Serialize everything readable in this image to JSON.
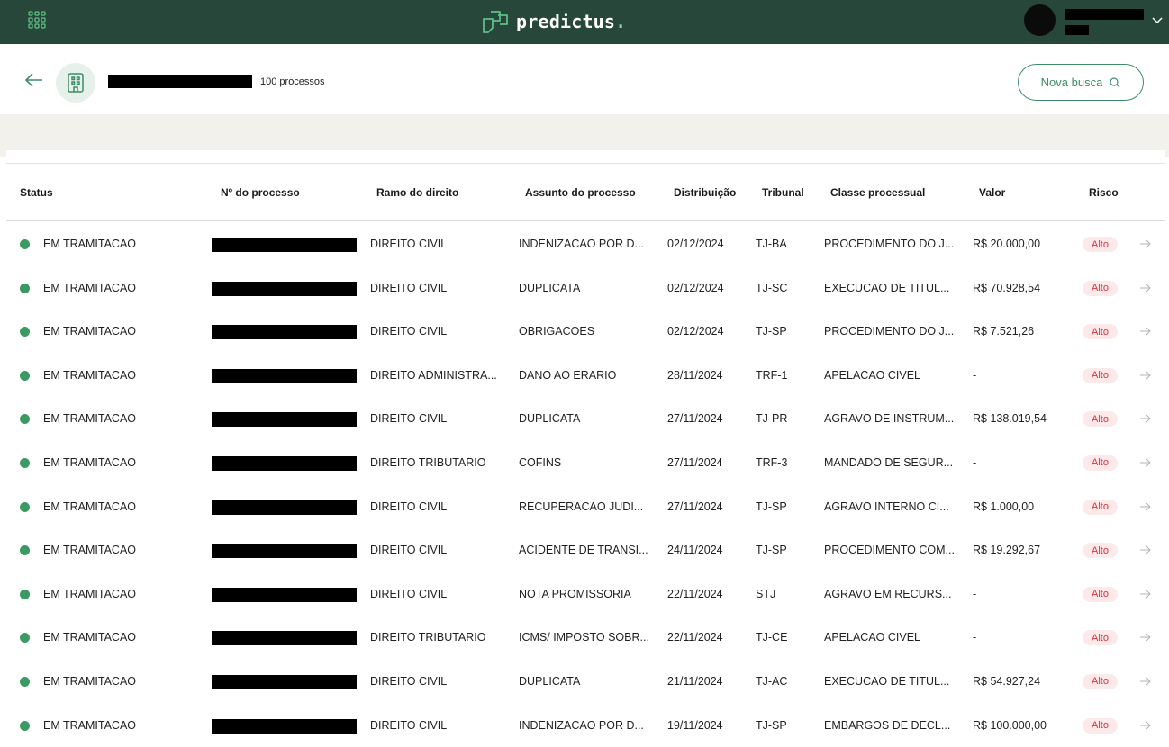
{
  "topbar": {
    "logo_text": "predictus",
    "logo_dot": ".",
    "icons": {
      "apps": "grid-icon",
      "chevron": "chevron-down-icon"
    }
  },
  "header": {
    "process_count": "100 processos",
    "nova_busca": "Nova busca",
    "icons": {
      "back": "arrow-left-icon",
      "entity": "building-icon",
      "search": "search-icon"
    }
  },
  "colors": {
    "topbar": "#26473a",
    "accent": "#3f8c68",
    "status_dot": "#3a9a62",
    "risk_text": "#d9333f",
    "risk_bg": "#fde9ea",
    "band": "#f2f1ec"
  },
  "table": {
    "columns": {
      "status": "Status",
      "numero": "Nº do processo",
      "ramo": "Ramo do direito",
      "assunto": "Assunto do processo",
      "distribuicao": "Distribuição",
      "tribunal": "Tribunal",
      "classe": "Classe processual",
      "valor": "Valor",
      "risco": "Risco"
    },
    "rows": [
      {
        "status": "EM TRAMITACAO",
        "ramo": "DIREITO CIVIL",
        "assunto": "INDENIZACAO POR D...",
        "distribuicao": "02/12/2024",
        "tribunal": "TJ-BA",
        "classe": "PROCEDIMENTO DO J...",
        "valor": "R$ 20.000,00",
        "risco": "Alto"
      },
      {
        "status": "EM TRAMITACAO",
        "ramo": "DIREITO CIVIL",
        "assunto": "DUPLICATA",
        "distribuicao": "02/12/2024",
        "tribunal": "TJ-SC",
        "classe": "EXECUCAO DE TITUL...",
        "valor": "R$ 70.928,54",
        "risco": "Alto"
      },
      {
        "status": "EM TRAMITACAO",
        "ramo": "DIREITO CIVIL",
        "assunto": "OBRIGACOES",
        "distribuicao": "02/12/2024",
        "tribunal": "TJ-SP",
        "classe": "PROCEDIMENTO DO J...",
        "valor": "R$ 7.521,26",
        "risco": "Alto"
      },
      {
        "status": "EM TRAMITACAO",
        "ramo": "DIREITO ADMINISTRA...",
        "assunto": "DANO AO ERARIO",
        "distribuicao": "28/11/2024",
        "tribunal": "TRF-1",
        "classe": "APELACAO CIVEL",
        "valor": "-",
        "risco": "Alto"
      },
      {
        "status": "EM TRAMITACAO",
        "ramo": "DIREITO CIVIL",
        "assunto": "DUPLICATA",
        "distribuicao": "27/11/2024",
        "tribunal": "TJ-PR",
        "classe": "AGRAVO DE INSTRUM...",
        "valor": "R$ 138.019,54",
        "risco": "Alto"
      },
      {
        "status": "EM TRAMITACAO",
        "ramo": "DIREITO TRIBUTARIO",
        "assunto": "COFINS",
        "distribuicao": "27/11/2024",
        "tribunal": "TRF-3",
        "classe": "MANDADO DE SEGUR...",
        "valor": "-",
        "risco": "Alto"
      },
      {
        "status": "EM TRAMITACAO",
        "ramo": "DIREITO CIVIL",
        "assunto": "RECUPERACAO JUDI...",
        "distribuicao": "27/11/2024",
        "tribunal": "TJ-SP",
        "classe": "AGRAVO INTERNO CI...",
        "valor": "R$ 1.000,00",
        "risco": "Alto"
      },
      {
        "status": "EM TRAMITACAO",
        "ramo": "DIREITO CIVIL",
        "assunto": "ACIDENTE DE TRANSI...",
        "distribuicao": "24/11/2024",
        "tribunal": "TJ-SP",
        "classe": "PROCEDIMENTO COM...",
        "valor": "R$ 19.292,67",
        "risco": "Alto"
      },
      {
        "status": "EM TRAMITACAO",
        "ramo": "DIREITO CIVIL",
        "assunto": "NOTA PROMISSORIA",
        "distribuicao": "22/11/2024",
        "tribunal": "STJ",
        "classe": "AGRAVO EM RECURS...",
        "valor": "-",
        "risco": "Alto"
      },
      {
        "status": "EM TRAMITACAO",
        "ramo": "DIREITO TRIBUTARIO",
        "assunto": "ICMS/ IMPOSTO SOBR...",
        "distribuicao": "22/11/2024",
        "tribunal": "TJ-CE",
        "classe": "APELACAO CIVEL",
        "valor": "-",
        "risco": "Alto"
      },
      {
        "status": "EM TRAMITACAO",
        "ramo": "DIREITO CIVIL",
        "assunto": "DUPLICATA",
        "distribuicao": "21/11/2024",
        "tribunal": "TJ-AC",
        "classe": "EXECUCAO DE TITUL...",
        "valor": "R$ 54.927,24",
        "risco": "Alto"
      },
      {
        "status": "EM TRAMITACAO",
        "ramo": "DIREITO CIVIL",
        "assunto": "INDENIZACAO POR D...",
        "distribuicao": "19/11/2024",
        "tribunal": "TJ-SP",
        "classe": "EMBARGOS DE DECL...",
        "valor": "R$ 100.000,00",
        "risco": "Alto"
      }
    ]
  }
}
